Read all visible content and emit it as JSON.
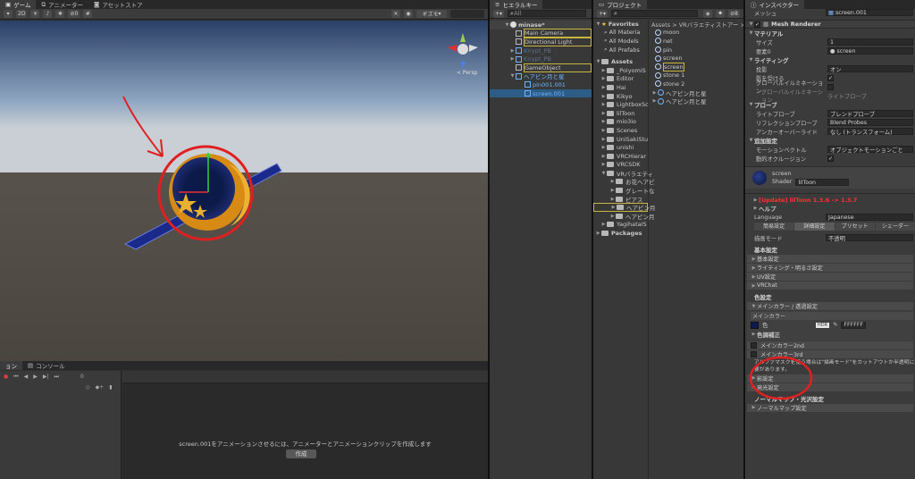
{
  "scene_panel": {
    "tabs": [
      "ゲーム",
      "アニメーター",
      "アセットストア"
    ],
    "toolbar": {
      "mode_2d": "2D",
      "gizmo_label": "ギズモ",
      "count_label": "0"
    },
    "persp_label": "< Persp"
  },
  "animation_panel": {
    "tabs": [
      "ョン",
      "コンソール"
    ],
    "frame": "0",
    "message": "screen.001をアニメーションさせるには、アニメーターとアニメーションクリップを作成します",
    "create_button": "作成"
  },
  "hierarchy": {
    "tab": "ヒエラルキー",
    "search_placeholder": "All",
    "scene_name": "minase*",
    "items": [
      {
        "label": "Main Camera",
        "type": "go",
        "indent": 2
      },
      {
        "label": "Directional Light",
        "type": "go",
        "indent": 2
      },
      {
        "label": "Kirypt_PB",
        "type": "prefab-dim",
        "indent": 2
      },
      {
        "label": "Kirypt_PB",
        "type": "prefab-dim",
        "indent": 2
      },
      {
        "label": "GameObject",
        "type": "go",
        "indent": 2
      },
      {
        "label": "ヘアピン月と星",
        "type": "prefab",
        "indent": 2
      },
      {
        "label": "pin001.001",
        "type": "child",
        "indent": 3
      },
      {
        "label": "screen.001",
        "type": "child-selected",
        "indent": 3
      }
    ]
  },
  "project": {
    "tab": "プロジェクト",
    "favorites_label": "Favorites",
    "favorites": [
      "All Materia",
      "All Models",
      "All Prefabs"
    ],
    "assets_label": "Assets",
    "folders": [
      "_PoiyomiS",
      "Editor",
      "Hai",
      "Kikyo",
      "LightboxSc",
      "lilToon",
      "mio3io",
      "Scenes",
      "UniSakiStu",
      "unishi",
      "VRCHierar",
      "VRCSDK",
      "VRバラエティ",
      "お花ヘアピ",
      "グレートな",
      "ピアス",
      "ヘアピン月",
      "ヘアピン月",
      "YagihataIS"
    ],
    "packages_label": "Packages",
    "breadcrumb": "Assets > VRバラエティストアー >",
    "assets": [
      "moon",
      "net",
      "pin",
      "screen",
      "screen",
      "stone 1",
      "stone 2",
      "ヘアピン月と星",
      "ヘアピン月と星"
    ],
    "badge_count": "8"
  },
  "inspector": {
    "tab": "インスペクター",
    "mesh_label": "メッシュ",
    "mesh_value": "screen.001",
    "component": "Mesh Renderer",
    "materials_header": "マテリアル",
    "size_label": "サイズ",
    "size_value": "1",
    "element_label": "要素0",
    "element_value": "screen",
    "lighting_header": "ライティング",
    "cast_label": "投影",
    "cast_value": "オン",
    "receive_label": "影を受ける",
    "gi_label": "グローバルイルミネーション",
    "gi2_label": "グローバルイルミネーション",
    "gi2_value": "ライトプローブ",
    "probes_header": "プローブ",
    "lightprobe_label": "ライトプローブ",
    "lightprobe_value": "ブレンドプローブ",
    "reflection_label": "リフレクションプローブ",
    "reflection_value": "Blend Probes",
    "anchor_label": "アンカーオーバーライド",
    "anchor_value": "なし (トランスフォーム)",
    "extra_header": "追加設定",
    "motion_label": "モーションベクトル",
    "motion_value": "オブジェクトモーションごと",
    "occlusion_label": "動的オクルージョン",
    "material_name": "screen",
    "shader_label": "Shader",
    "shader_value": "lilToon",
    "update_notice": "[Update] lilToon 1.3.6 -> 1.3.7",
    "help_label": "ヘルプ",
    "language_label": "Language",
    "language_value": "Japanese",
    "mode_tabs": [
      "簡易設定",
      "詳細設定",
      "プリセット",
      "シェーダー"
    ],
    "render_mode_label": "描画モード",
    "render_mode_value": "不透明",
    "basic_header": "基本設定",
    "foldouts": [
      "基本設定",
      "ライティング・明るさ設定",
      "UV設定",
      "VRChat"
    ],
    "color_header": "色設定",
    "main_color_bar": "メインカラー / 透過設定",
    "main_color_title": "メインカラー",
    "color_label": "色",
    "hdr_label": "HDR",
    "color_hex": "FFFFFF",
    "tone_label": "色調補正",
    "main_color2": "メインカラー2nd",
    "main_color3": "メインカラー3rd",
    "alpha_note": "アルファマスクを使う場合は\"描画モード\"をカットアウトか半透明に変更",
    "alpha_note2": "要があります。",
    "lower_bars": [
      "影設定",
      "発光設定"
    ],
    "normal_header": "ノーマルマップ・光沢設定",
    "normal_bar": "ノーマルマップ設定"
  },
  "colors": {
    "accent_red": "#e02020",
    "selection": "#2c5d87",
    "prefab_blue": "#6fb3ff",
    "update_red": "#ff3030"
  }
}
